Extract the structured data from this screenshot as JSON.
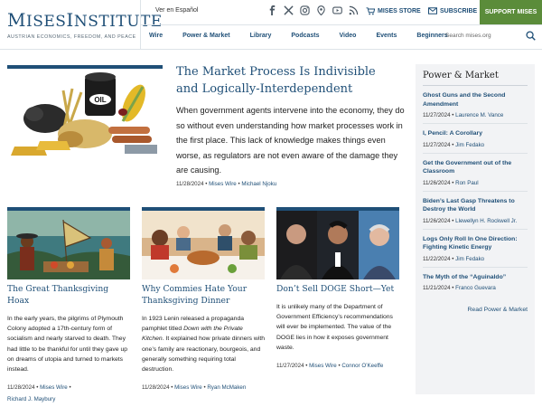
{
  "header": {
    "logo_main": "MisesInstitute",
    "logo_tagline": "AUSTRIAN ECONOMICS, FREEDOM, AND PEACE",
    "lang_link": "Ver en Español",
    "store_label": "MISES STORE",
    "subscribe_label": "SUBSCRIBE",
    "support_label": "SUPPORT MISES",
    "search_placeholder": "Search mises.org",
    "social_icons": [
      "facebook-icon",
      "x-icon",
      "instagram-icon",
      "pin-icon",
      "youtube-icon",
      "rss-icon"
    ],
    "nav": [
      "Wire",
      "Power & Market",
      "Library",
      "Podcasts",
      "Video",
      "Events",
      "Beginners"
    ]
  },
  "feature": {
    "title": "The Market Process Is Indivisible and Logically-Interdependent",
    "body": "When government agents intervene into the economy, they do so without even understanding how market processes work in the first place. This lack of knowledge makes things even worse, as regulators are not even aware of the damage they are causing.",
    "date": "11/28/2024",
    "section": "Mises Wire",
    "author": "Michael Njoku"
  },
  "cards": [
    {
      "title": "The Great Thanksgiving Hoax",
      "body": "In the early years, the pilgrims of Plymouth Colony adopted a 17th-century form of socialism and nearly starved to death. They had little to be thankful for until they gave up on dreams of utopia and turned to markets instead.",
      "date": "11/28/2024",
      "section": "Mises Wire",
      "author": "Richard J. Maybury"
    },
    {
      "title": "Why Commies Hate Your Thanksgiving Dinner",
      "body_pre": "In 1923 Lenin released a propaganda pamphlet titled ",
      "body_em": "Down with the Private Kitchen",
      "body_post": ". It explained how private dinners with one’s family are reactionary, bourgeois, and generally something requiring total destruction.",
      "date": "11/28/2024",
      "section": "Mises Wire",
      "author": "Ryan McMaken"
    },
    {
      "title": "Don’t Sell DOGE Short—Yet",
      "body": "It is unlikely many of the Department of Government Efficiency’s recommendations will ever be implemented. The value of the DOGE lies in how it exposes government waste.",
      "date": "11/27/2024",
      "section": "Mises Wire",
      "author": "Connor O’Keeffe"
    }
  ],
  "sidebar": {
    "title": "Power & Market",
    "items": [
      {
        "title": "Ghost Guns and the Second Amendment",
        "date": "11/27/2024",
        "author": "Laurence M. Vance"
      },
      {
        "title": "I, Pencil: A Corollary",
        "date": "11/27/2024",
        "author": "Jim Fedako"
      },
      {
        "title": "Get the Government out of the Classroom",
        "date": "11/26/2024",
        "author": "Ron Paul"
      },
      {
        "title": "Biden’s Last Gasp Threatens to Destroy the World",
        "date": "11/26/2024",
        "author": "Llewellyn H. Rockwell Jr."
      },
      {
        "title": "Logs Only Roll In One Direction: Fighting Kinetic Energy",
        "date": "11/22/2024",
        "author": "Jim Fedako"
      },
      {
        "title": "The Myth of the “Aguinaldo”",
        "date": "11/21/2024",
        "author": "Franco Guevara"
      }
    ],
    "more_label": "Read Power & Market"
  },
  "colors": {
    "brand_blue": "#1f4f77",
    "support_green": "#5b8c3a",
    "sidebar_bg": "#f2f3f5"
  }
}
